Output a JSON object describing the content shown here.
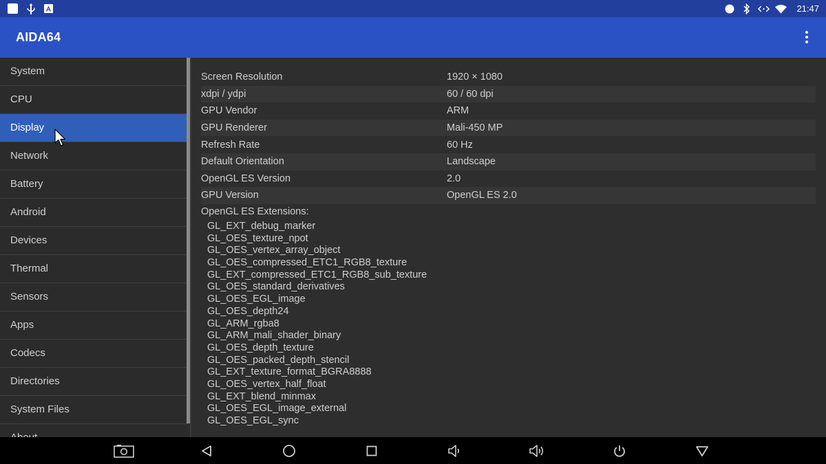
{
  "statusbar": {
    "left_icons": [
      "notification-square-icon",
      "usb-icon",
      "app-notification-icon"
    ],
    "right_icons": [
      "record-icon",
      "bluetooth-icon",
      "data-sync-icon",
      "wifi-icon"
    ],
    "time": "21:47"
  },
  "app": {
    "title": "AIDA64",
    "menu_icon": "overflow-menu-icon"
  },
  "sidebar": {
    "items": [
      {
        "label": "System"
      },
      {
        "label": "CPU"
      },
      {
        "label": "Display"
      },
      {
        "label": "Network"
      },
      {
        "label": "Battery"
      },
      {
        "label": "Android"
      },
      {
        "label": "Devices"
      },
      {
        "label": "Thermal"
      },
      {
        "label": "Sensors"
      },
      {
        "label": "Apps"
      },
      {
        "label": "Codecs"
      },
      {
        "label": "Directories"
      },
      {
        "label": "System Files"
      },
      {
        "label": "About"
      }
    ],
    "active": "Display"
  },
  "display": {
    "rows": [
      {
        "label": "Screen Resolution",
        "value": "1920 × 1080"
      },
      {
        "label": "xdpi / ydpi",
        "value": "60 / 60 dpi"
      },
      {
        "label": "GPU Vendor",
        "value": "ARM"
      },
      {
        "label": "GPU Renderer",
        "value": "Mali-450 MP"
      },
      {
        "label": "Refresh Rate",
        "value": "60 Hz"
      },
      {
        "label": "Default Orientation",
        "value": "Landscape"
      },
      {
        "label": "OpenGL ES Version",
        "value": "2.0"
      },
      {
        "label": "GPU Version",
        "value": "OpenGL ES 2.0"
      }
    ],
    "extensions_header": "OpenGL ES Extensions:",
    "extensions": [
      "GL_EXT_debug_marker",
      "GL_OES_texture_npot",
      "GL_OES_vertex_array_object",
      "GL_OES_compressed_ETC1_RGB8_texture",
      "GL_EXT_compressed_ETC1_RGB8_sub_texture",
      "GL_OES_standard_derivatives",
      "GL_OES_EGL_image",
      "GL_OES_depth24",
      "GL_ARM_rgba8",
      "GL_ARM_mali_shader_binary",
      "GL_OES_depth_texture",
      "GL_OES_packed_depth_stencil",
      "GL_EXT_texture_format_BGRA8888",
      "GL_OES_vertex_half_float",
      "GL_EXT_blend_minmax",
      "GL_OES_EGL_image_external",
      "GL_OES_EGL_sync"
    ]
  },
  "navbar": {
    "buttons": [
      "screenshot-icon",
      "back-icon",
      "home-icon",
      "recents-icon",
      "volume-down-icon",
      "volume-up-icon",
      "power-icon",
      "hide-navbar-icon"
    ]
  },
  "colors": {
    "statusbar": "#223f9e",
    "appbar": "#2b52c4",
    "active_item": "#2f5fb8",
    "background": "#2e2e2e"
  }
}
